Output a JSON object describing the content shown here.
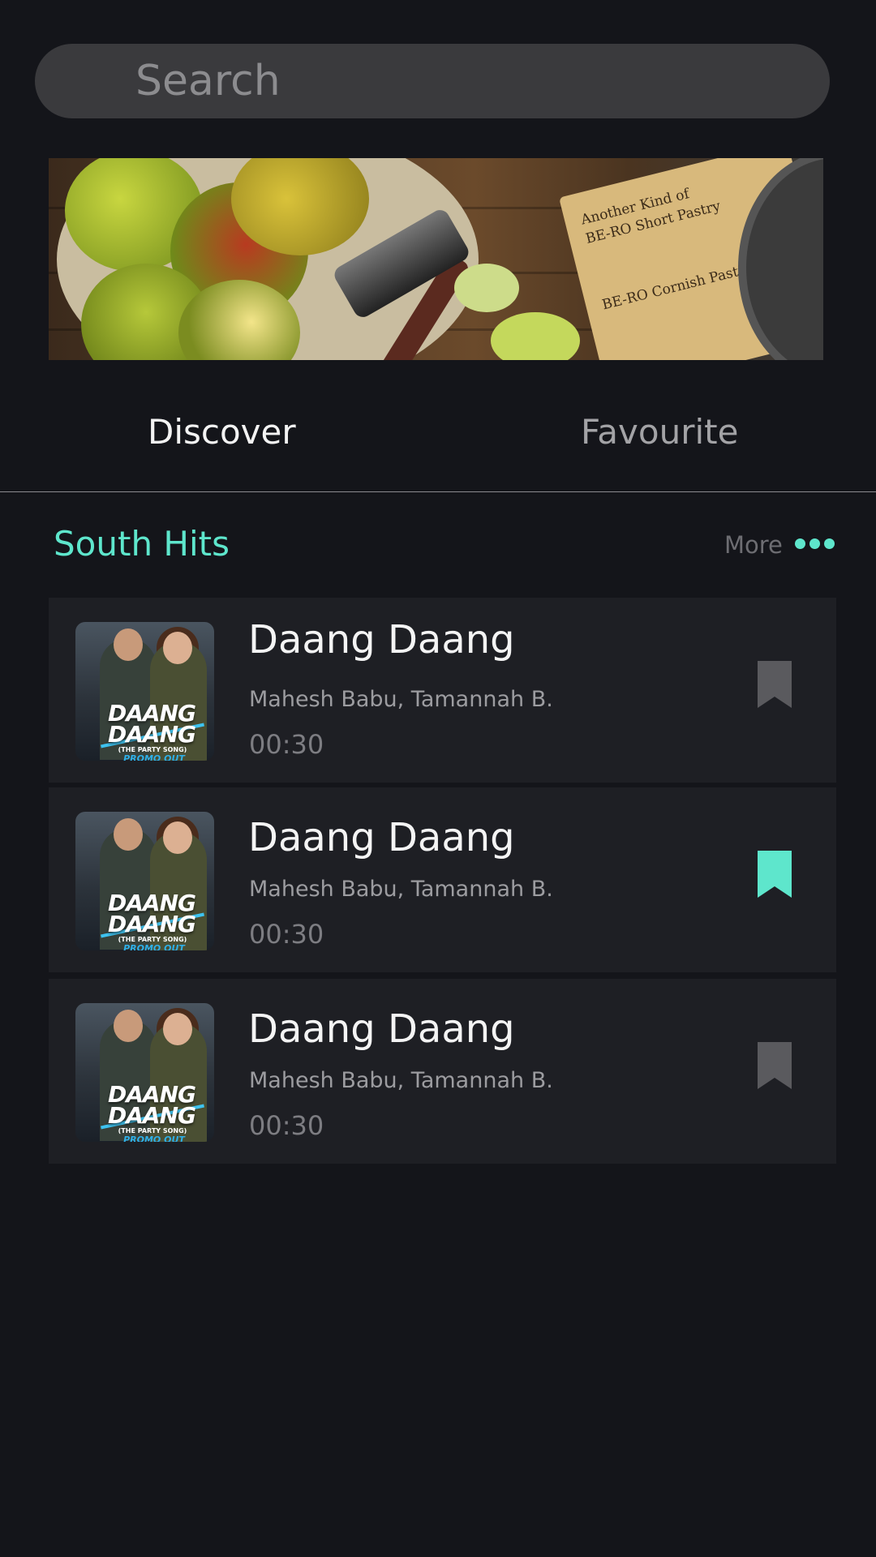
{
  "search": {
    "placeholder": "Search"
  },
  "banner": {
    "book_text": [
      "Another Kind of",
      "BE-RO Short Pastry",
      "BE-RO Cornish Pasties"
    ]
  },
  "tabs": [
    {
      "label": "Discover",
      "active": true
    },
    {
      "label": "Favourite",
      "active": false
    }
  ],
  "section": {
    "title": "South Hits",
    "more_label": "More",
    "accent_color": "#5ee6cc"
  },
  "songs": [
    {
      "title": "Daang Daang",
      "artists": "Mahesh Babu, Tamannah B.",
      "duration": "00:30",
      "bookmarked": false,
      "thumb": {
        "title_line1": "DAANG",
        "title_line2": "DAANG",
        "subtitle": "(THE PARTY SONG)",
        "promo": "PROMO OUT NOW"
      }
    },
    {
      "title": "Daang Daang",
      "artists": "Mahesh Babu, Tamannah B.",
      "duration": "00:30",
      "bookmarked": true,
      "thumb": {
        "title_line1": "DAANG",
        "title_line2": "DAANG",
        "subtitle": "(THE PARTY SONG)",
        "promo": "PROMO OUT NOW"
      }
    },
    {
      "title": "Daang Daang",
      "artists": "Mahesh Babu, Tamannah B.",
      "duration": "00:30",
      "bookmarked": false,
      "thumb": {
        "title_line1": "DAANG",
        "title_line2": "DAANG",
        "subtitle": "(THE PARTY SONG)",
        "promo": "PROMO OUT NOW"
      }
    }
  ],
  "colors": {
    "background": "#14151a",
    "card": "#1e1f24",
    "bookmark_active": "#5ee6cc",
    "bookmark_inactive": "#5a5a5e"
  }
}
